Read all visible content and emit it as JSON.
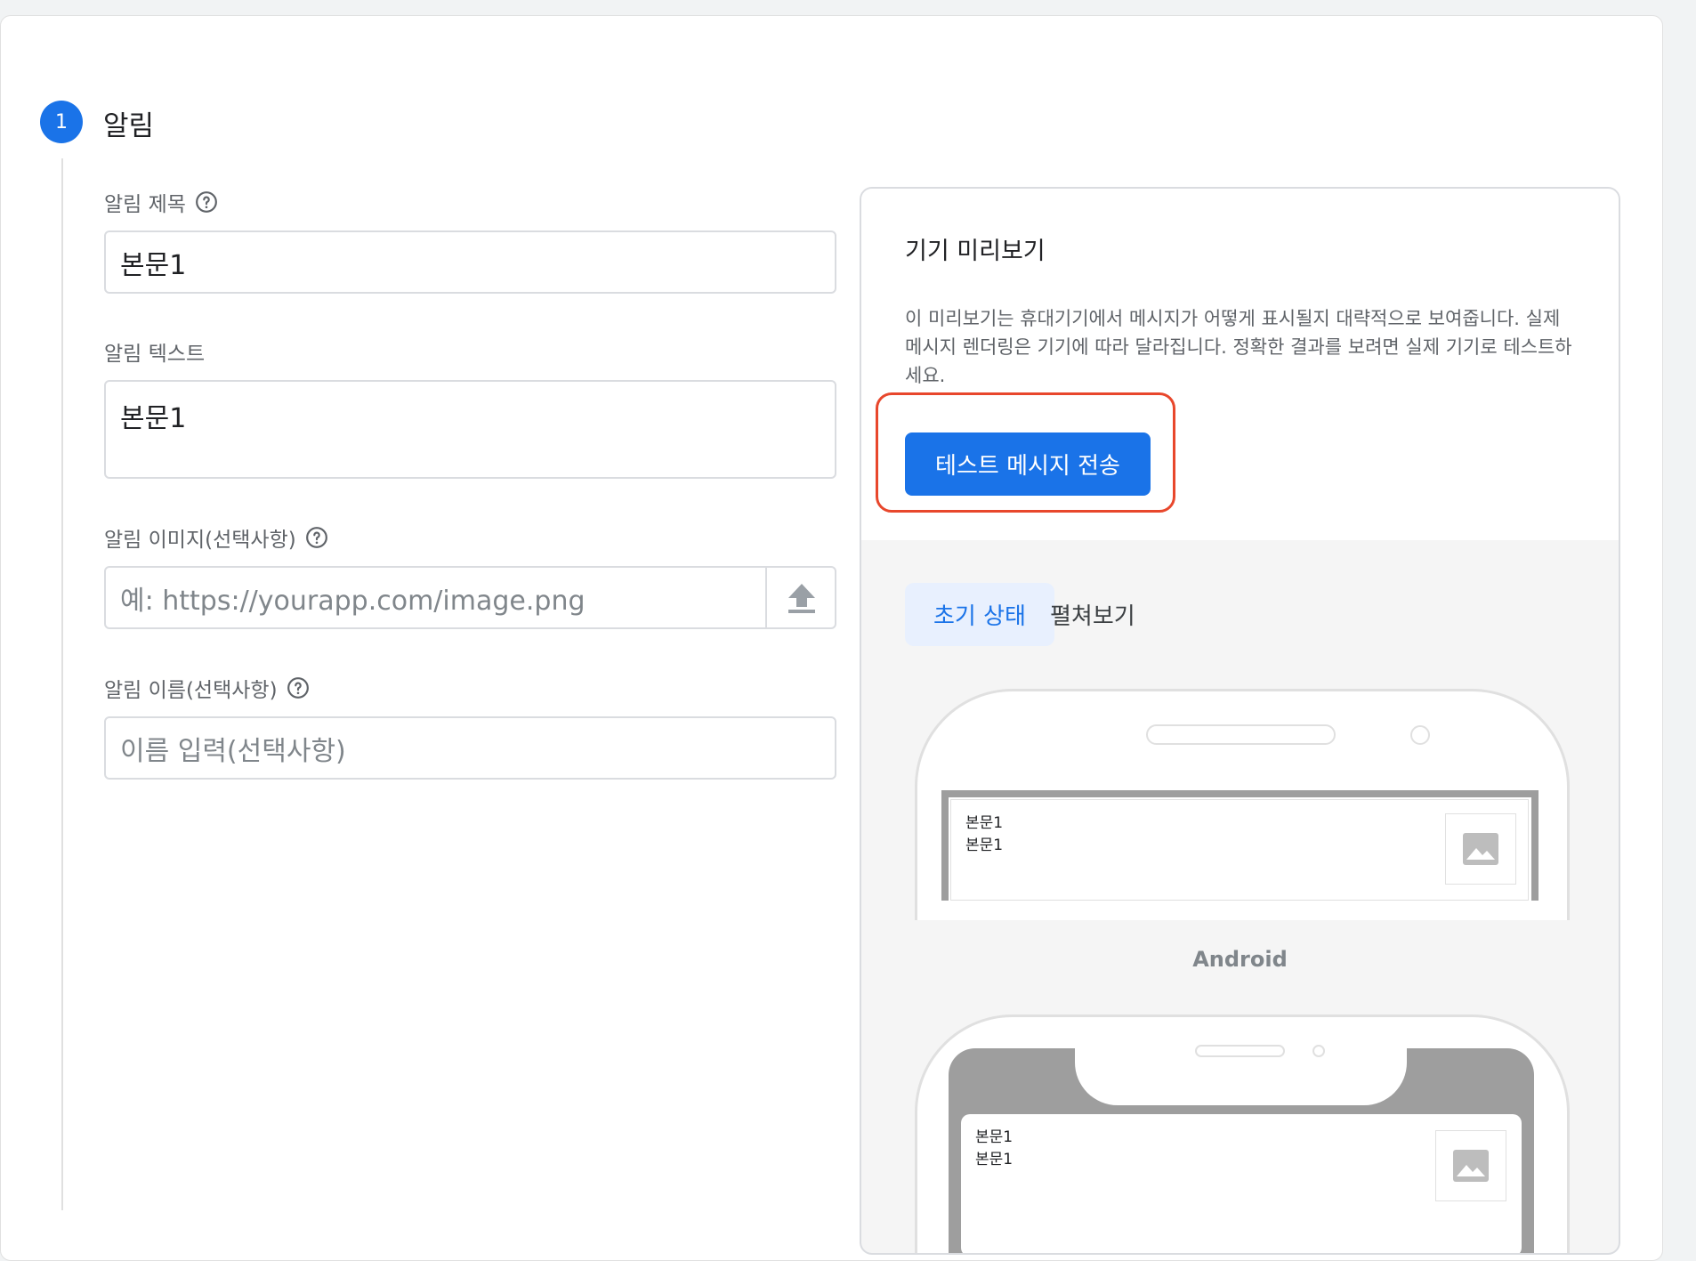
{
  "step": {
    "number": "1",
    "title": "알림"
  },
  "fields": {
    "title": {
      "label": "알림 제목",
      "value": "본문1"
    },
    "text": {
      "label": "알림 텍스트",
      "value": "본문1"
    },
    "image": {
      "label": "알림 이미지(선택사항)",
      "placeholder": "예: https://yourapp.com/image.png"
    },
    "name": {
      "label": "알림 이름(선택사항)",
      "placeholder": "이름 입력(선택사항)"
    }
  },
  "preview": {
    "title": "기기 미리보기",
    "description": "이 미리보기는 휴대기기에서 메시지가 어떻게 표시될지 대략적으로 보여줍니다. 실제 메시지 렌더링은 기기에 따라 달라집니다. 정확한 결과를 보려면 실제 기기로 테스트하세요.",
    "send_button": "테스트 메시지 전송",
    "tabs": [
      {
        "label": "초기 상태",
        "active": true
      },
      {
        "label": "펼쳐보기",
        "active": false
      }
    ],
    "platform_label": "Android",
    "notification": {
      "title": "본문1",
      "body": "본문1"
    }
  },
  "colors": {
    "accent": "#1a73e8",
    "highlight": "#e8472c"
  }
}
